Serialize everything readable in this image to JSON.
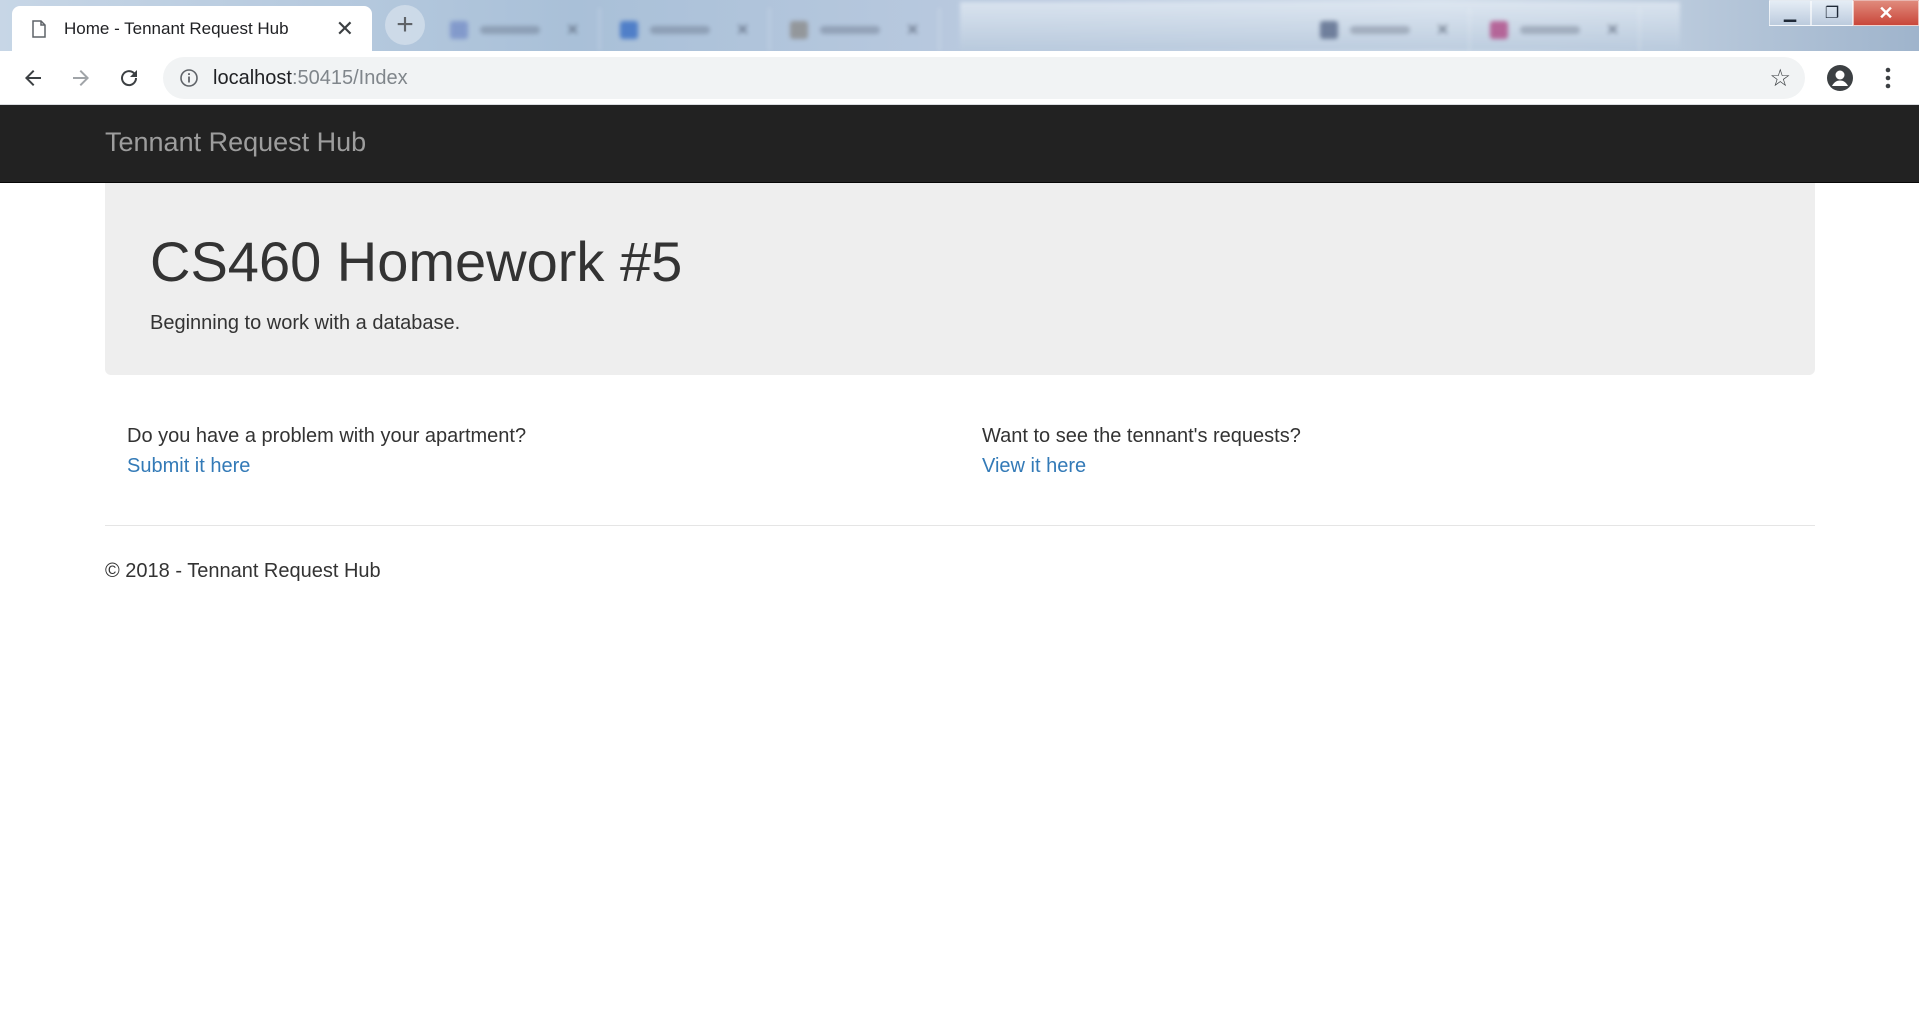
{
  "browser": {
    "tab_title": "Home - Tennant Request Hub",
    "url_host": "localhost",
    "url_rest": ":50415/Index"
  },
  "navbar": {
    "brand": "Tennant Request Hub"
  },
  "jumbotron": {
    "title": "CS460 Homework #5",
    "lead": "Beginning to work with a database."
  },
  "columns": [
    {
      "question": "Do you have a problem with your apartment?",
      "link": "Submit it here"
    },
    {
      "question": "Want to see the tennant's requests?",
      "link": "View it here"
    }
  ],
  "footer": {
    "text": "© 2018 - Tennant Request Hub"
  },
  "colors": {
    "navbar_bg": "#222222",
    "brand": "#9d9d9d",
    "jumbotron_bg": "#eeeeee",
    "link": "#337ab7"
  },
  "icons": [
    "page-icon",
    "close-icon",
    "new-tab-icon",
    "back-icon",
    "forward-icon",
    "reload-icon",
    "info-icon",
    "star-icon",
    "profile-icon",
    "menu-icon",
    "minimize-icon",
    "restore-icon",
    "window-close-icon"
  ]
}
